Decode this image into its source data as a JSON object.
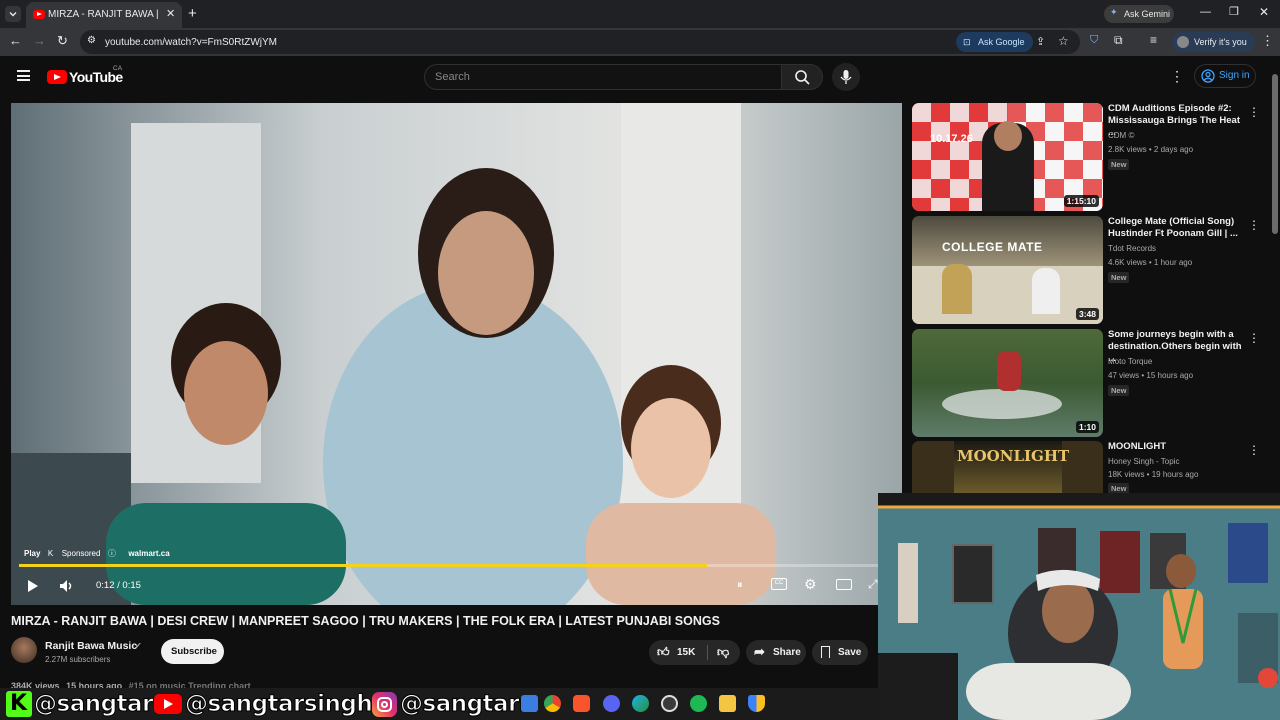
{
  "browser": {
    "tab_title": "MIRZA - RANJIT BAWA | DESI C",
    "url": "youtube.com/watch?v=FmS0RtZWjYM",
    "ask_google": "Ask Google",
    "verify": "Verify it's you",
    "ask_gemini": "Ask Gemini"
  },
  "youtube": {
    "logo_text": "YouTube",
    "region": "CA",
    "search_placeholder": "Search",
    "sign_in": "Sign in"
  },
  "player": {
    "sponsored_play": "Play",
    "sponsored_k": "K",
    "sponsored_label": "Sponsored",
    "advertiser": "walmart.ca",
    "time": "0:12 / 0:15",
    "progress": 0.8
  },
  "video": {
    "title": "MIRZA - RANJIT BAWA | DESI CREW | MANPREET SAGOO | TRU MAKERS | THE FOLK ERA | LATEST PUNJABI SONGS",
    "channel": "Ranjit Bawa Music",
    "subscribers": "2.27M subscribers",
    "subscribe": "Subscribe",
    "likes": "15K",
    "share": "Share",
    "save": "Save",
    "meta_views": "384K views",
    "meta_time": "15 hours ago",
    "meta_trending": "#15 on music Trending chart"
  },
  "related": [
    {
      "title": "CDM Auditions Episode #2: Mississauga Brings The Heat ...",
      "channel": "CDM ©",
      "meta": "2.8K views • 2 days ago",
      "badge": "New",
      "duration": "1:15:10",
      "thumb_text": "10.17.26"
    },
    {
      "title": "College Mate (Official Song) Hustinder Ft Poonam Gill | ...",
      "channel": "Tdot Records",
      "meta": "4.6K views • 1 hour ago",
      "badge": "New",
      "duration": "3:48",
      "thumb_text": "COLLEGE MATE"
    },
    {
      "title": "Some journeys begin with a destination.Others begin with ...",
      "channel": "Moto Torque",
      "meta": "47 views • 15 hours ago",
      "badge": "New",
      "duration": "1:10",
      "thumb_text": ""
    },
    {
      "title": "MOONLIGHT",
      "channel": "Honey Singh - Topic",
      "meta": "18K views • 19 hours ago",
      "badge": "New",
      "duration": "",
      "thumb_text": "MOONLIGHT"
    }
  ],
  "overlay": {
    "k_letter": "K",
    "handle_1": "@sangtar",
    "handle_2": "@sangtarsingh",
    "handle_3": "@sangtarr"
  },
  "colors": {
    "progress": "#f2d21a",
    "youtube_red": "#ff0000",
    "subscribe_bg": "#f1f1f1",
    "signin_blue": "#3ea6ff"
  }
}
